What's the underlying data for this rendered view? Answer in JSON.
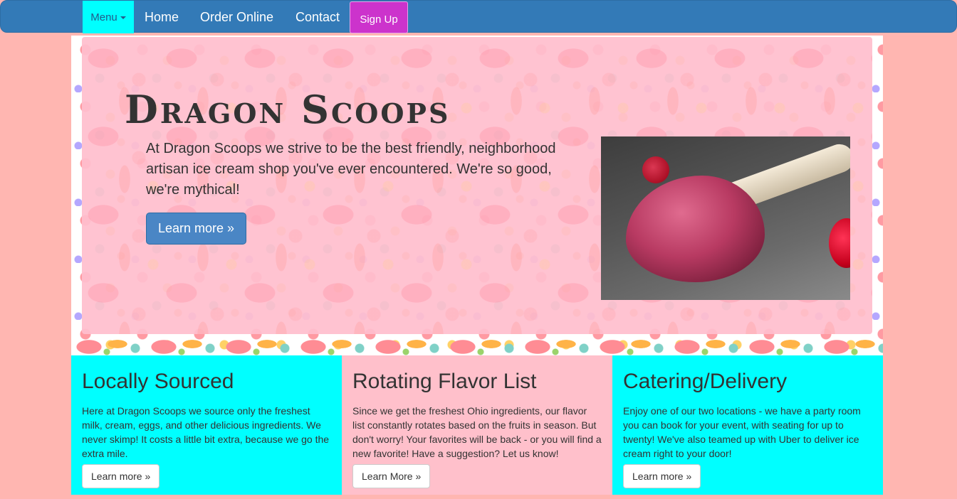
{
  "navbar": {
    "menu_label": "Menu",
    "links": [
      "Home",
      "Order Online",
      "Contact"
    ],
    "signup_label": "Sign Up"
  },
  "hero": {
    "title": "Dragon Scoops",
    "text": "At Dragon Scoops we strive to be the best friendly, neighborhood artisan ice cream shop you've ever encountered. We're so good, we're mythical!",
    "button_label": "Learn more »"
  },
  "features": [
    {
      "title": "Locally Sourced",
      "text": "Here at Dragon Scoops we source only the freshest milk, cream, eggs, and other delicious ingredients. We never skimp! It costs a little bit extra, because we go the extra mile.",
      "button_label": "Learn more »"
    },
    {
      "title": "Rotating Flavor List",
      "text": "Since we get the freshest Ohio ingredients, our flavor list constantly rotates based on the fruits in season. But don't worry! Your favorites will be back - or you will find a new favorite! Have a suggestion? Let us know!",
      "button_label": "Learn More »"
    },
    {
      "title": "Catering/Delivery",
      "text": "Enjoy one of our two locations - we have a party room you can book for your event, with seating for up to twenty! We've also teamed up with Uber to deliver ice cream right to your door!",
      "button_label": "Learn more »"
    }
  ],
  "colors": {
    "page_bg": "#ffb6b1",
    "navbar": "#337ab7",
    "menu_bg": "#00ffff",
    "signup_bg": "#cc33cc",
    "hero_bg": "#ffc0cb",
    "feature_cyan": "#00ffff",
    "feature_pink": "#ffc0cb"
  }
}
